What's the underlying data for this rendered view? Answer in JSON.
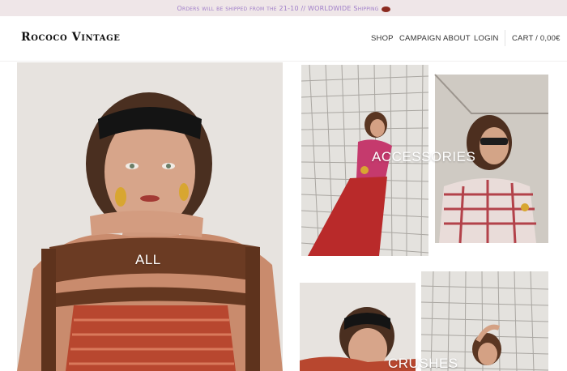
{
  "announcement": {
    "text": "Orders will be shipped from the 21-10 // WORLDWIDE Shipping"
  },
  "header": {
    "logo": "Rococo Vintage",
    "nav": [
      "SHOP",
      "CAMPAIGN",
      "ABOUT",
      "LOGIN"
    ],
    "cart": "CART / 0,00€"
  },
  "tiles": {
    "all": "ALL",
    "accessories": "ACCESSORIES",
    "crushes": "CRUSHES"
  }
}
